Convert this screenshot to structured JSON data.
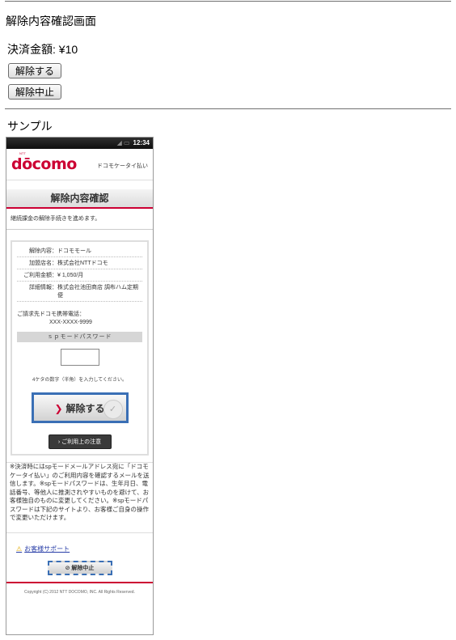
{
  "page": {
    "title": "解除内容確認画面",
    "amount_label": "決済金額: ¥10",
    "cancel_button": "解除する",
    "abort_button": "解除中止",
    "sample_label": "サンプル"
  },
  "phone": {
    "status_time": "12:34",
    "logo": "dōcomo",
    "logo_tag": "NTT",
    "brand_service": "ドコモケータイ払い",
    "title": "解除内容確認",
    "intro": "継続課金の解除手続きを進めます。",
    "details": [
      {
        "key": "解除内容：",
        "value": "ドコモモール"
      },
      {
        "key": "加盟店名：",
        "value": "株式会社NTTドコモ"
      },
      {
        "key": "ご利用金額：",
        "value": "¥ 1,050/月"
      },
      {
        "key": "詳細情報：",
        "value": "株式会社池田商店 調布ハム定期便"
      }
    ],
    "billing_label": "ご請求先ドコモ携帯電話：",
    "billing_number": "XXX-XXXX-9999",
    "password_label": "ｓｐモードパスワード",
    "password_hint": "4ケタの数字（半角）を入力してください。",
    "cancel_button": "解除する",
    "notice_button": "ご利用上の注意",
    "notes": "※決済時にはspモードメールアドレス宛に「ドコモ ケータイ払い」のご利用内容を確認するメールを送信します。※spモードパスワードは、生年月日、電話番号、等他人に推測されやすいものを避けて、お客様独自のものに変更してください。※spモードパスワードは下記のサイトより、お客様ご自身の操作で変更いただけます。",
    "support_link": "お客様サポート",
    "abort_button": "解除中止",
    "copyright": "Copyright (C) 2012 NTT DOCOMO, INC. All Rights Reserved."
  },
  "colors": {
    "brand": "#cc0033",
    "focus_outline": "#3a6fb5",
    "link": "#2a3fa8"
  },
  "icons": {
    "chevron": "chevron-right-icon",
    "warning": "warning-icon",
    "block": "prohibited-icon",
    "check": "check-circle-icon"
  }
}
